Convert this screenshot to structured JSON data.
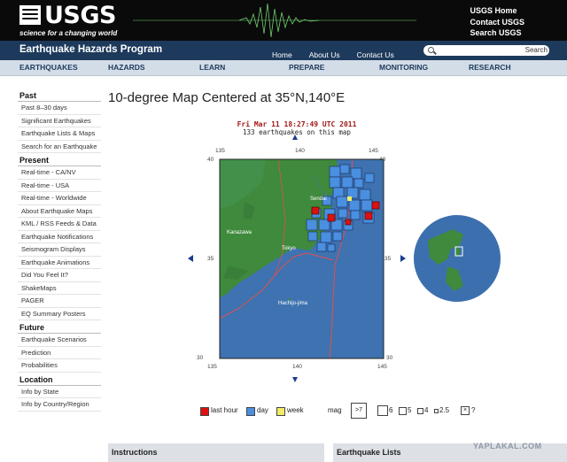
{
  "header": {
    "logo_text": "USGS",
    "tagline": "science for a changing world",
    "links": [
      "USGS Home",
      "Contact USGS",
      "Search USGS"
    ]
  },
  "program": {
    "title": "Earthquake Hazards Program",
    "links": [
      "Home",
      "About Us",
      "Contact Us"
    ],
    "search_button": "Search"
  },
  "nav": [
    "EARTHQUAKES",
    "HAZARDS",
    "LEARN",
    "PREPARE",
    "MONITORING",
    "RESEARCH"
  ],
  "sidebar": [
    {
      "title": "Past",
      "items": [
        "Past 8–30 days",
        "Significant Earthquakes",
        "Earthquake Lists & Maps",
        "Search for an Earthquake"
      ]
    },
    {
      "title": "Present",
      "items": [
        "Real-time - CA/NV",
        "Real-time - USA",
        "Real-time - Worldwide",
        "About Earthquake Maps",
        "KML / RSS Feeds & Data",
        "Earthquake Notifications",
        "Seismogram Displays",
        "Earthquake Animations",
        "Did You Feel It?",
        "ShakeMaps",
        "PAGER",
        "EQ Summary Posters"
      ]
    },
    {
      "title": "Future",
      "items": [
        "Earthquake Scenarios",
        "Prediction",
        "Probabilities"
      ]
    },
    {
      "title": "Location",
      "items": [
        "Info by State",
        "Info by Country/Region"
      ]
    }
  ],
  "page_title": "10-degree Map Centered at 35°N,140°E",
  "map": {
    "date": "Fri Mar 11 18:27:49 UTC 2011",
    "count_text": "133 earthquakes on this map",
    "top_ticks": [
      "135",
      "140",
      "145"
    ],
    "bottom_ticks": [
      "135",
      "140",
      "145"
    ],
    "left_ticks": [
      "40",
      "35",
      "30"
    ],
    "right_ticks": [
      "40",
      "35",
      "30"
    ],
    "places": [
      "Sendai",
      "Kanazawa",
      "Tokyo",
      "Hachijo-jima"
    ]
  },
  "legend": {
    "last_hour": "last hour",
    "day": "day",
    "week": "week",
    "mag": "mag",
    "mag_values": [
      ">7",
      "6",
      "5",
      "4",
      "2.5",
      "?"
    ],
    "colors": {
      "last_hour": "#dd1111",
      "day": "#4a8fe0",
      "week": "#f0ec66"
    }
  },
  "bottom": {
    "instructions": "Instructions",
    "lists": "Earthquake Lists"
  },
  "watermark": "YAPLAKAL.COM"
}
